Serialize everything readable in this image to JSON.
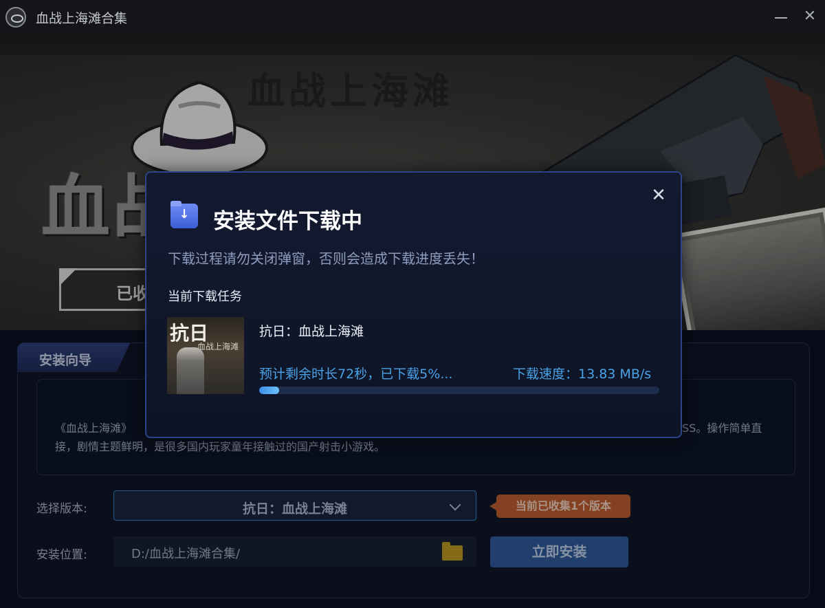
{
  "window": {
    "title": "血战上海滩合集"
  },
  "hero": {
    "big_title": "血战上海滩",
    "watermark": "血战上海滩",
    "collected_label": "已收"
  },
  "guide": {
    "tab_label": "安装向导",
    "description_line1": "《血战上海滩》",
    "description_line1_end": "SS。操作简单直",
    "description_line2": "接，剧情主题鲜明，是很多国内玩家童年接触过的国产射击小游戏。",
    "version_label": "选择版本:",
    "version_value": "抗日：血战上海滩",
    "version_badge": "当前已收集1个版本",
    "path_label": "安装位置:",
    "path_value": "D:/血战上海滩合集/",
    "install_button": "立即安装"
  },
  "modal": {
    "title": "安装文件下载中",
    "warning": "下载过程请勿关闭弹窗，否则会造成下载进度丢失！",
    "section_title": "当前下载任务",
    "task": {
      "cover_title": "抗日",
      "cover_subtitle": "血战上海滩",
      "name": "抗日：血战上海滩",
      "progress_text": "预计剩余时长72秒，已下载5%...",
      "speed_text": "下载速度：13.83 MB/s",
      "progress_percent": 5
    }
  },
  "icons": {
    "app": "app-logo-icon",
    "minimize": "minimize-icon",
    "close": "close-icon",
    "modal_close": "close-icon",
    "download": "download-folder-icon",
    "folder": "folder-icon",
    "dropdown": "chevron-down-icon"
  },
  "colors": {
    "accent": "#4aa3e8",
    "badge": "#b5582a",
    "install_button": "#2c5590",
    "modal_border": "#2d4488"
  }
}
